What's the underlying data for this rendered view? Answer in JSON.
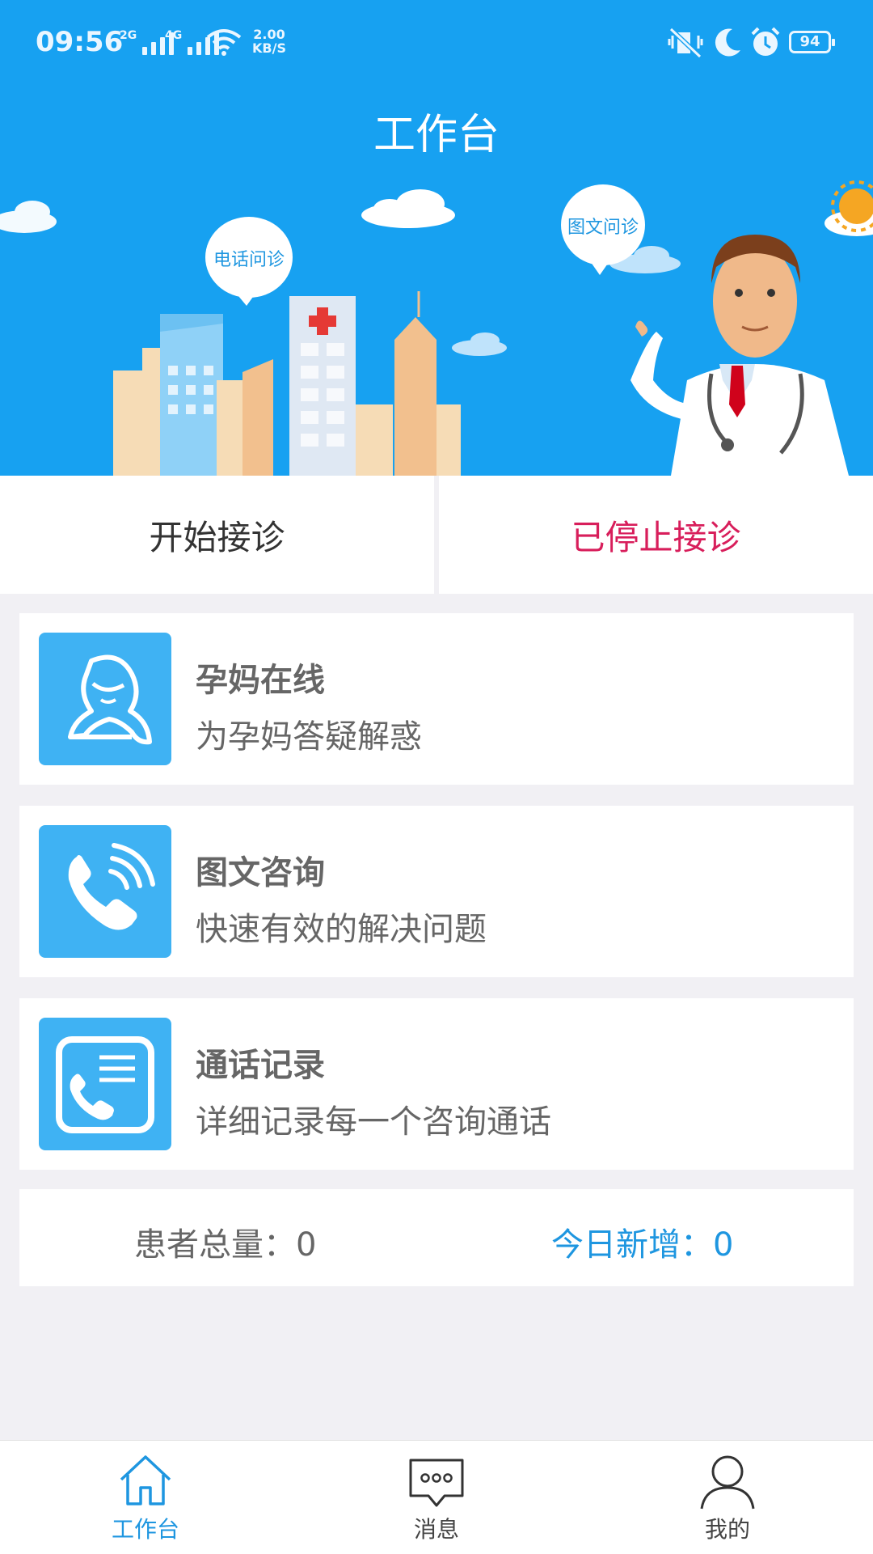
{
  "status_bar": {
    "time": "09:56",
    "network_1": "2G",
    "network_2": "4G",
    "speed_value": "2.00",
    "speed_unit": "KB/S",
    "battery": "94"
  },
  "header": {
    "title": "工作台",
    "bubble_phone": "电话问诊",
    "bubble_text": "图文问诊"
  },
  "toggle": {
    "start_label": "开始接诊",
    "stopped_label": "已停止接诊"
  },
  "cards": [
    {
      "title": "孕妈在线",
      "desc": "为孕妈答疑解惑",
      "icon": "woman-icon"
    },
    {
      "title": "图文咨询",
      "desc": "快速有效的解决问题",
      "icon": "phone-icon"
    },
    {
      "title": "通话记录",
      "desc": "详细记录每一个咨询通话",
      "icon": "call-record-icon"
    }
  ],
  "stats": {
    "total_label": "患者总量：",
    "total_value": "0",
    "new_label": "今日新增：",
    "new_value": "0"
  },
  "tabbar": {
    "tabs": [
      {
        "label": "工作台",
        "icon": "home-icon",
        "active": true
      },
      {
        "label": "消息",
        "icon": "message-icon",
        "active": false
      },
      {
        "label": "我的",
        "icon": "user-icon",
        "active": false
      }
    ]
  },
  "colors": {
    "header_bg": "#17a1f1",
    "accent": "#1e96e0",
    "stopped": "#d81e5b",
    "card_icon_bg": "#3fb2f3"
  }
}
